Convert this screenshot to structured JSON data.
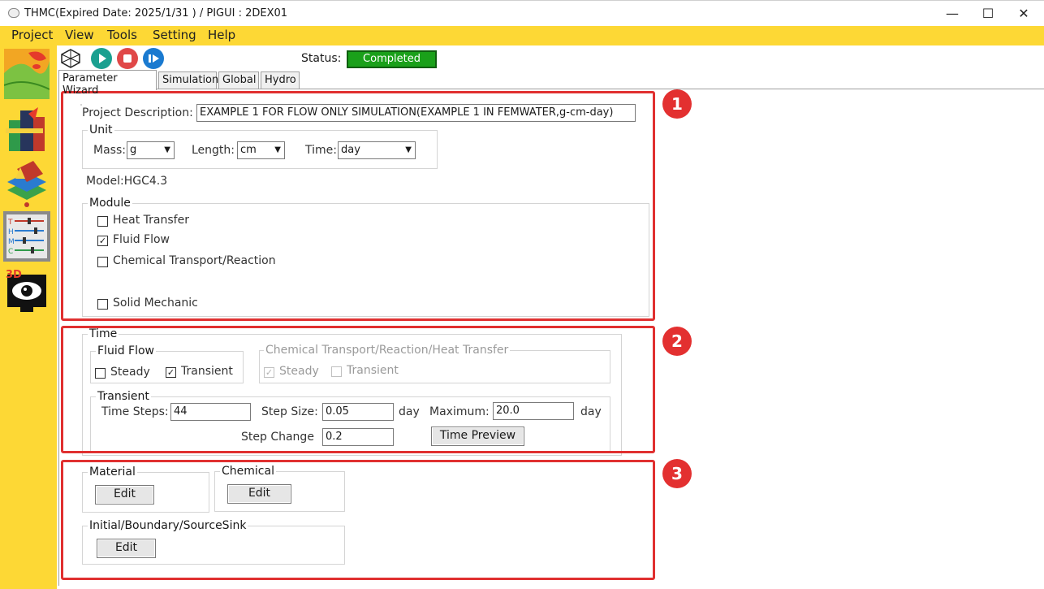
{
  "window": {
    "title": "THMC(Expired Date: 2025/1/31 ) / PIGUI : 2DEX01",
    "minimize": "—",
    "maximize": "☐",
    "close": "✕"
  },
  "menu": [
    "Project",
    "View",
    "Tools",
    "Setting",
    "Help"
  ],
  "sidebar": {
    "icons": [
      "map-contour-icon",
      "books-icon",
      "mesh-layers-icon",
      "thmc-sliders-icon",
      "3d-eye-icon"
    ],
    "thmc_text": "THMC",
    "eye_text": "3D"
  },
  "toolbar": {
    "buttons": [
      "mesh-icon",
      "play-icon",
      "stop-icon",
      "step-icon"
    ],
    "status_label": "Status:",
    "status_value": "Completed",
    "status_color": "#1aa01a"
  },
  "tabs": [
    "Parameter Wizard",
    "Simulation",
    "Global",
    "Hydro"
  ],
  "project": {
    "description_label": "Project Description:",
    "description_value": "EXAMPLE 1 FOR FLOW ONLY SIMULATION(EXAMPLE 1 IN FEMWATER,g-cm-day)"
  },
  "unit": {
    "legend": "Unit",
    "mass_label": "Mass:",
    "mass_value": "g",
    "length_label": "Length:",
    "length_value": "cm",
    "time_label": "Time:",
    "time_value": "day"
  },
  "model": "Model:HGC4.3",
  "module": {
    "legend": "Module",
    "items": [
      {
        "label": "Heat Transfer",
        "checked": false
      },
      {
        "label": "Fluid Flow",
        "checked": true
      },
      {
        "label": "Chemical Transport/Reaction",
        "checked": false
      },
      {
        "label": "Solid Mechanic",
        "checked": false
      }
    ]
  },
  "time": {
    "legend": "Time",
    "fluid_flow": {
      "legend": "Fluid Flow",
      "steady": "Steady",
      "transient": "Transient",
      "steady_checked": false,
      "transient_checked": true
    },
    "chemical": {
      "legend": "Chemical Transport/Reaction/Heat Transfer",
      "steady": "Steady",
      "transient": "Transient",
      "steady_checked": true,
      "transient_checked": false
    },
    "transient": {
      "legend": "Transient",
      "time_steps_label": "Time Steps:",
      "time_steps_value": "44",
      "step_size_label": "Step Size:",
      "step_size_value": "0.05",
      "step_size_unit": "day",
      "maximum_label": "Maximum:",
      "maximum_value": "20.0",
      "maximum_unit": "day",
      "step_change_label": "Step Change",
      "step_change_value": "0.2",
      "preview_button": "Time Preview"
    }
  },
  "editors": {
    "material": {
      "legend": "Material",
      "button": "Edit"
    },
    "chemical": {
      "legend": "Chemical",
      "button": "Edit"
    },
    "ibs": {
      "legend": "Initial/Boundary/SourceSink",
      "button": "Edit"
    }
  },
  "annotations": [
    "1",
    "2",
    "3"
  ],
  "colors": {
    "accent_yellow": "#fdd835",
    "highlight_red": "#e03030"
  }
}
